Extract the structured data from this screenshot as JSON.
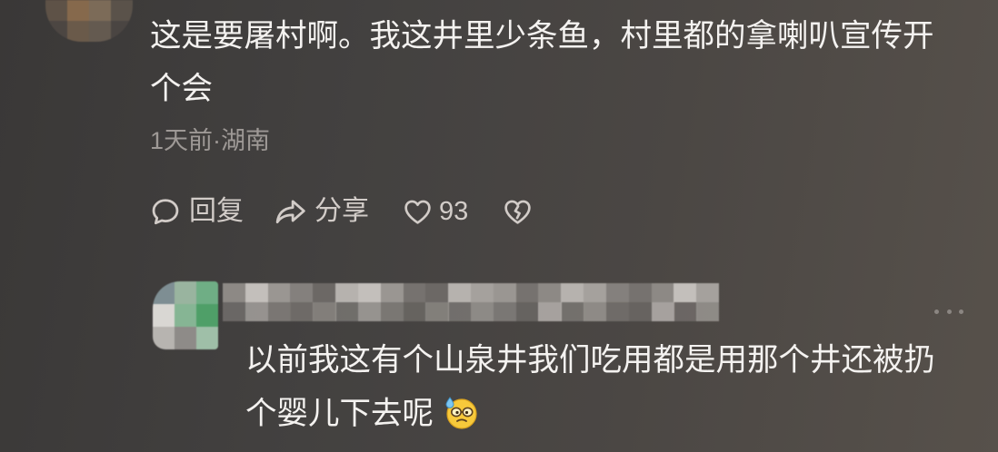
{
  "comment": {
    "text": "这是要屠村啊。我这井里少条鱼，村里都的拿喇叭宣传开个会",
    "meta": "1天前·湖南",
    "actions": {
      "reply_label": "回复",
      "share_label": "分享",
      "like_count": "93"
    }
  },
  "reply": {
    "text": "以前我这有个山泉井我们吃用都是用那个井还被扔个婴儿下去呢",
    "emoji": "sweat-face-emoji"
  },
  "icons": {
    "reply": "comment-bubble-icon",
    "share": "share-arrow-icon",
    "like": "heart-icon",
    "dislike": "broken-heart-icon",
    "more": "more-horizontal-icon"
  },
  "colors": {
    "background": "#45423f",
    "primary_text": "#f4f2f0",
    "meta_text": "#9e9996",
    "action_text": "#d2ccc8",
    "more_dots": "#8b8682"
  }
}
